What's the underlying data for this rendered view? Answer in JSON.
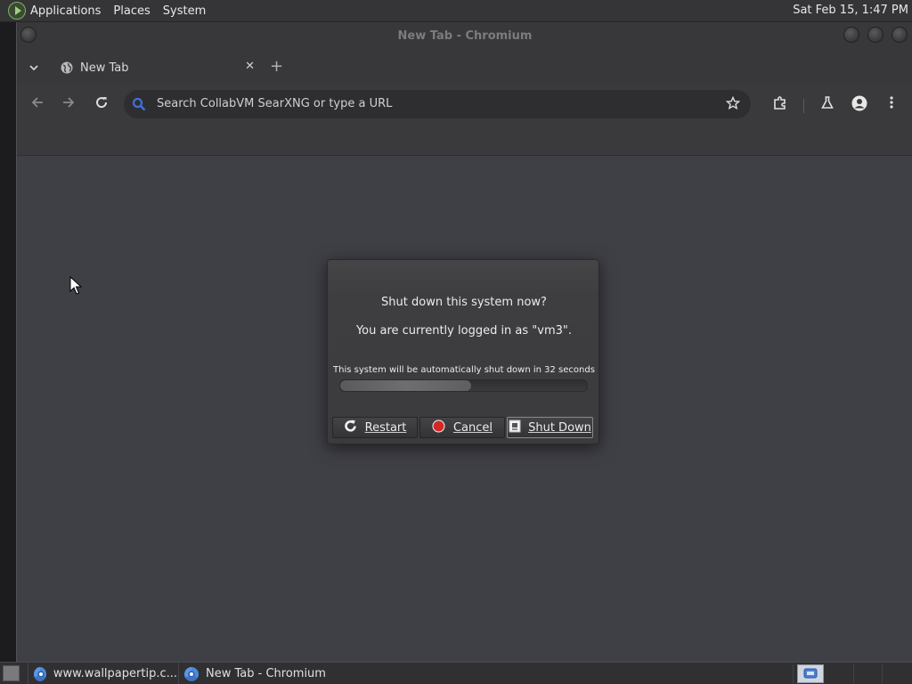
{
  "top_panel": {
    "menus": [
      "Applications",
      "Places",
      "System"
    ],
    "clock": "Sat Feb 15,  1:47 PM"
  },
  "browser": {
    "window_title": "New Tab - Chromium",
    "tab": {
      "label": "New Tab",
      "close": "✕"
    },
    "new_tab": "+",
    "omnibox": {
      "text": "Search CollabVM SearXNG or type a URL"
    }
  },
  "dialog": {
    "title": "Shut down this system now?",
    "subtitle": "You are currently logged in as \"vm3\".",
    "countdown": "This system will be automatically shut down in 32 seconds",
    "progress_fraction": 0.53,
    "buttons": {
      "restart": "Restart",
      "cancel": "Cancel",
      "shutdown": "Shut Down"
    }
  },
  "taskbar": {
    "tasks": [
      "www.wallpapertip.c...",
      "New Tab - Chromium"
    ]
  },
  "icons": {
    "accent_red": "#d42828",
    "accent_blue": "#4a8be0"
  }
}
